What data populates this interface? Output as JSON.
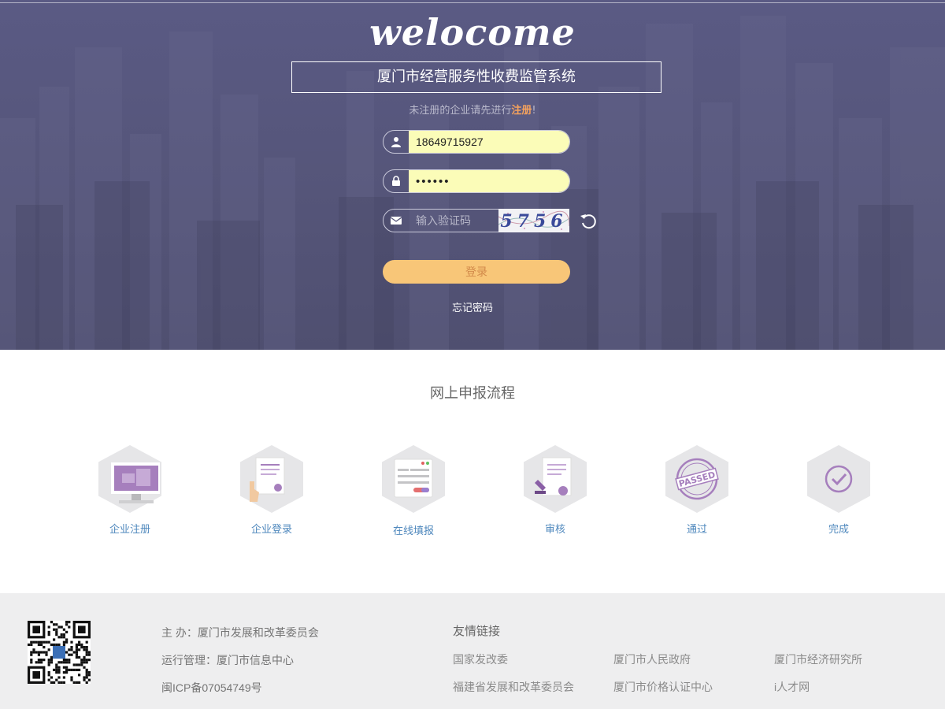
{
  "hero": {
    "brand": "welocome",
    "system_title": "厦门市经营服务性收费监管系统",
    "register_tip_prefix": "未注册的企业请先进行",
    "register_link": "注册",
    "register_tip_suffix": "!",
    "username_value": "18649715927",
    "password_value": "••••••",
    "captcha_placeholder": "输入验证码",
    "captcha_code": "5756",
    "login_label": "登录",
    "forgot_label": "忘记密码"
  },
  "process": {
    "title": "网上申报流程",
    "steps": [
      {
        "label": "企业注册",
        "icon": "monitor-icon"
      },
      {
        "label": "企业登录",
        "icon": "hand-document-icon"
      },
      {
        "label": "在线填报",
        "icon": "form-window-icon"
      },
      {
        "label": "审核",
        "icon": "stamp-document-icon"
      },
      {
        "label": "通过",
        "icon": "passed-stamp-icon"
      },
      {
        "label": "完成",
        "icon": "check-circle-icon"
      }
    ]
  },
  "footer": {
    "host": "主  办：厦门市发展和改革委员会",
    "operator": "运行管理：厦门市信息中心",
    "icp": "闽ICP备07054749号",
    "links_title": "友情链接",
    "links": [
      "国家发改委",
      "厦门市人民政府",
      "厦门市经济研究所",
      "福建省发展和改革委员会",
      "厦门市价格认证中心",
      "i人才网"
    ]
  },
  "colors": {
    "hero_bg": "#555579",
    "accent_orange": "#f5a25d",
    "login_button": "#f8c678",
    "input_autofill": "#fbfcb8",
    "step_label": "#4f88bd",
    "icon_purple": "#a67fbd",
    "footer_bg": "#eeeeef"
  }
}
